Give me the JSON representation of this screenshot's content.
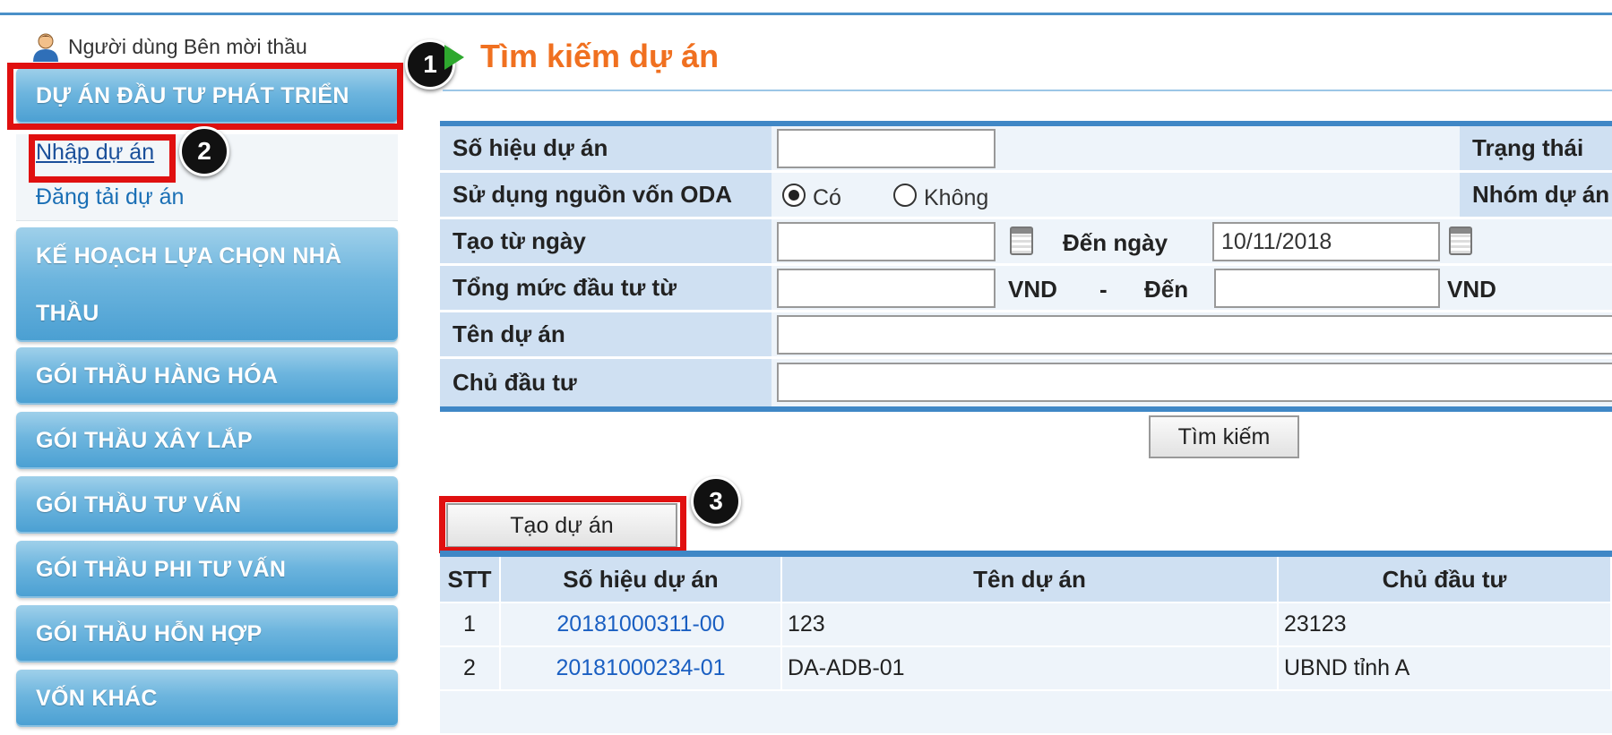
{
  "sidebar": {
    "user_label": "Người dùng Bên mời thầu",
    "active_section": "DỰ ÁN ĐẦU TƯ PHÁT TRIỂN",
    "sub_items": [
      "Nhập dự án",
      "Đăng tải dự án"
    ],
    "sections": [
      "KẾ HOẠCH LỰA CHỌN NHÀ",
      "THẦU",
      "GÓI THẦU HÀNG HÓA",
      "GÓI THẦU XÂY LẮP",
      "GÓI THẦU TƯ VẤN",
      "GÓI THẦU PHI TƯ VẤN",
      "GÓI THẦU HỖN HỢP",
      "VỐN KHÁC"
    ]
  },
  "badges": [
    "1",
    "2",
    "3"
  ],
  "main": {
    "title": "Tìm kiếm dự án",
    "form": {
      "project_code_label": "Số hiệu dự án",
      "status_label": "Trạng thái",
      "oda_label": "Sử dụng nguồn vốn ODA",
      "oda_yes": "Có",
      "oda_no": "Không",
      "oda_selected": "Có",
      "group_label": "Nhóm dự án",
      "from_date_label": "Tạo từ ngày",
      "from_date_value": "",
      "to_date_label": "Đến ngày",
      "to_date_value": "10/11/2018",
      "investment_label": "Tổng mức đầu tư từ",
      "currency": "VND",
      "dash": "-",
      "to_label": "Đến",
      "project_name_label": "Tên dự án",
      "owner_label": "Chủ đầu tư"
    },
    "search_button": "Tìm kiếm",
    "create_button": "Tạo dự án",
    "table": {
      "headers": [
        "STT",
        "Số hiệu dự án",
        "Tên dự án",
        "Chủ đầu tư"
      ],
      "rows": [
        [
          "1",
          "20181000311-00",
          "123",
          "23123"
        ],
        [
          "2",
          "20181000234-01",
          "DA-ADB-01",
          "UBND tỉnh A"
        ]
      ]
    }
  }
}
